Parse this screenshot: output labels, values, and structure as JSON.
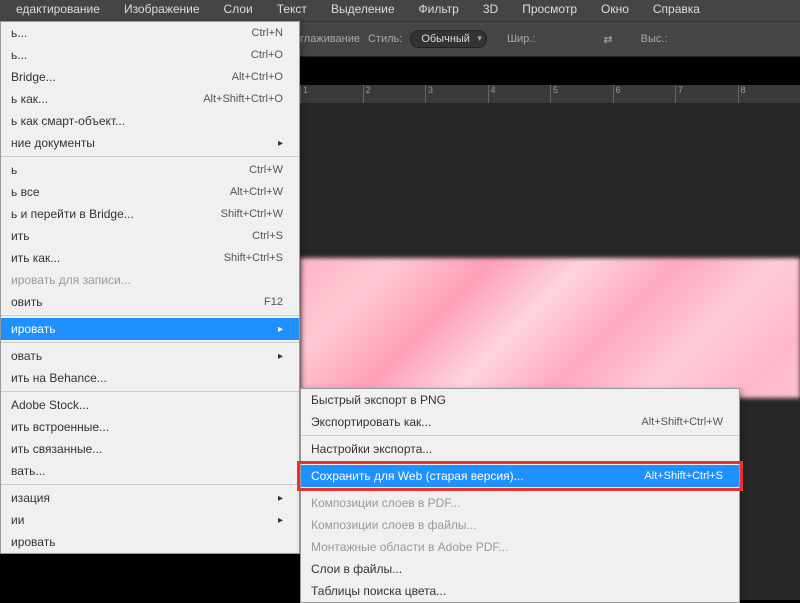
{
  "menubar": {
    "items": [
      "едактирование",
      "Изображение",
      "Слои",
      "Текст",
      "Выделение",
      "Фильтр",
      "3D",
      "Просмотр",
      "Окно",
      "Справка"
    ]
  },
  "options": {
    "sglazh_label": "глаживание",
    "style_label": "Стиль:",
    "style_value": "Обычный",
    "width_label": "Шир.:",
    "height_label": "Выс.:"
  },
  "ruler": {
    "marks": [
      "1",
      "2",
      "3",
      "4",
      "5",
      "6",
      "7",
      "8"
    ]
  },
  "file_menu": {
    "items": [
      {
        "label": "ь...",
        "shortcut": "Ctrl+N"
      },
      {
        "label": "ь...",
        "shortcut": "Ctrl+O"
      },
      {
        "label": "Bridge...",
        "shortcut": "Alt+Ctrl+O"
      },
      {
        "label": "ь как...",
        "shortcut": "Alt+Shift+Ctrl+O"
      },
      {
        "label": "ь как смарт-объект..."
      },
      {
        "label": "ние документы",
        "has_submenu": true
      },
      {
        "sep": true
      },
      {
        "label": "ь",
        "shortcut": "Ctrl+W"
      },
      {
        "label": "ь все",
        "shortcut": "Alt+Ctrl+W"
      },
      {
        "label": "ь и перейти в Bridge...",
        "shortcut": "Shift+Ctrl+W"
      },
      {
        "label": "ить",
        "shortcut": "Ctrl+S"
      },
      {
        "label": "ить как...",
        "shortcut": "Shift+Ctrl+S"
      },
      {
        "label": "ировать для записи...",
        "disabled": true
      },
      {
        "label": "овить",
        "shortcut": "F12"
      },
      {
        "sep": true
      },
      {
        "label": "ировать",
        "has_submenu": true,
        "highlighted": true
      },
      {
        "sep": true
      },
      {
        "label": "овать",
        "has_submenu": true
      },
      {
        "label": "ить на Behance..."
      },
      {
        "sep": true
      },
      {
        "label": "Adobe Stock..."
      },
      {
        "label": "ить встроенные..."
      },
      {
        "label": "ить связанные..."
      },
      {
        "label": "вать..."
      },
      {
        "sep": true
      },
      {
        "label": "изация",
        "has_submenu": true
      },
      {
        "label": "ии",
        "has_submenu": true
      },
      {
        "label": "ировать"
      }
    ]
  },
  "export_menu": {
    "items": [
      {
        "label": "Быстрый экспорт в PNG"
      },
      {
        "label": "Экспортировать как...",
        "shortcut": "Alt+Shift+Ctrl+W"
      },
      {
        "sep": true
      },
      {
        "label": "Настройки экспорта..."
      },
      {
        "sep": true
      },
      {
        "label": "Сохранить для Web (старая версия)...",
        "shortcut": "Alt+Shift+Ctrl+S",
        "highlighted": true,
        "red_box": true
      },
      {
        "sep": true
      },
      {
        "label": "Композиции слоев в PDF...",
        "disabled": true
      },
      {
        "label": "Композиции слоев в файлы...",
        "disabled": true
      },
      {
        "label": "Монтажные области в Adobe PDF...",
        "disabled": true
      },
      {
        "label": "Слои в файлы..."
      },
      {
        "label": "Таблицы поиска цвета..."
      }
    ]
  }
}
